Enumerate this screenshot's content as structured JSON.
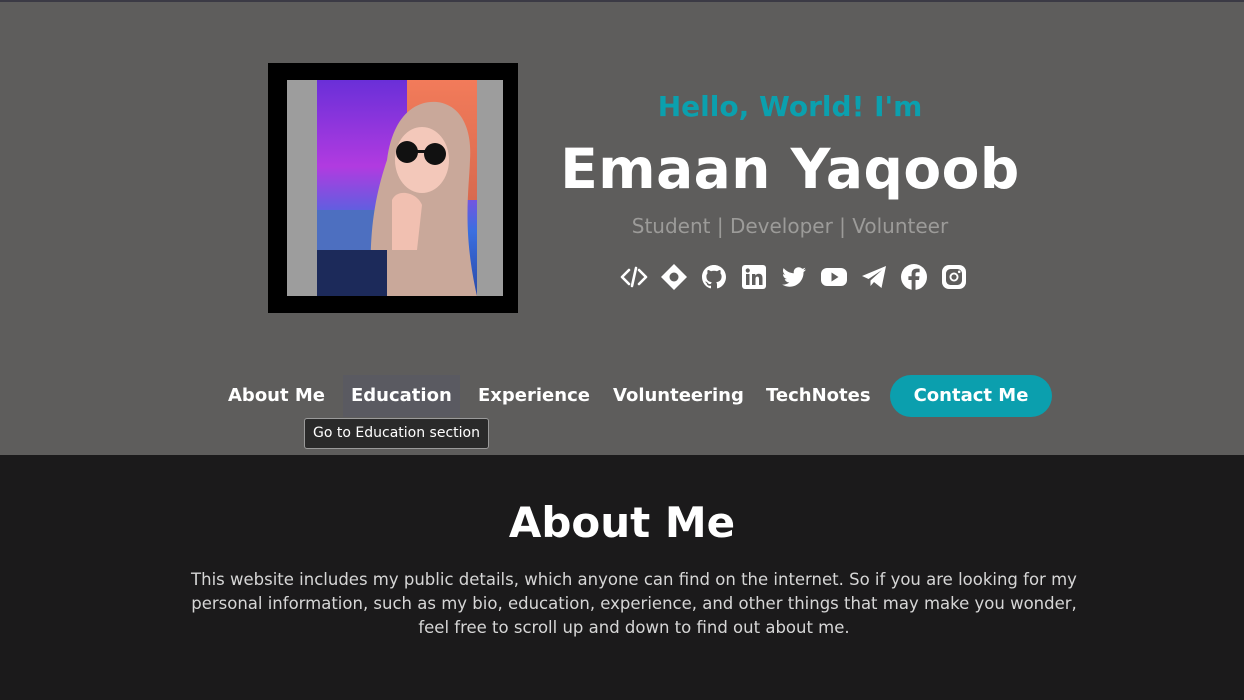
{
  "hero": {
    "greeting": "Hello, World! I'm",
    "name": "Emaan Yaqoob",
    "roles": "Student | Developer | Volunteer",
    "photo_alt": "profile photo",
    "socials": [
      {
        "icon": "code-icon"
      },
      {
        "icon": "diamond-icon"
      },
      {
        "icon": "github-icon"
      },
      {
        "icon": "linkedin-icon"
      },
      {
        "icon": "twitter-icon"
      },
      {
        "icon": "youtube-icon"
      },
      {
        "icon": "telegram-icon"
      },
      {
        "icon": "facebook-icon"
      },
      {
        "icon": "instagram-icon"
      }
    ]
  },
  "nav": {
    "items": [
      "About Me",
      "Education",
      "Experience",
      "Volunteering",
      "TechNotes"
    ],
    "contact": "Contact Me",
    "tooltip": "Go to Education section"
  },
  "about": {
    "title": "About Me",
    "text": "This website includes my public details, which anyone can find on the internet. So if you are looking for my personal information, such as my bio, education, experience, and other things that may make you wonder, feel free to scroll up and down to find out about me."
  },
  "colors": {
    "accent": "#0b9fae",
    "hero_bg": "#5e5d5c",
    "page_bg": "#1b1a1b"
  }
}
